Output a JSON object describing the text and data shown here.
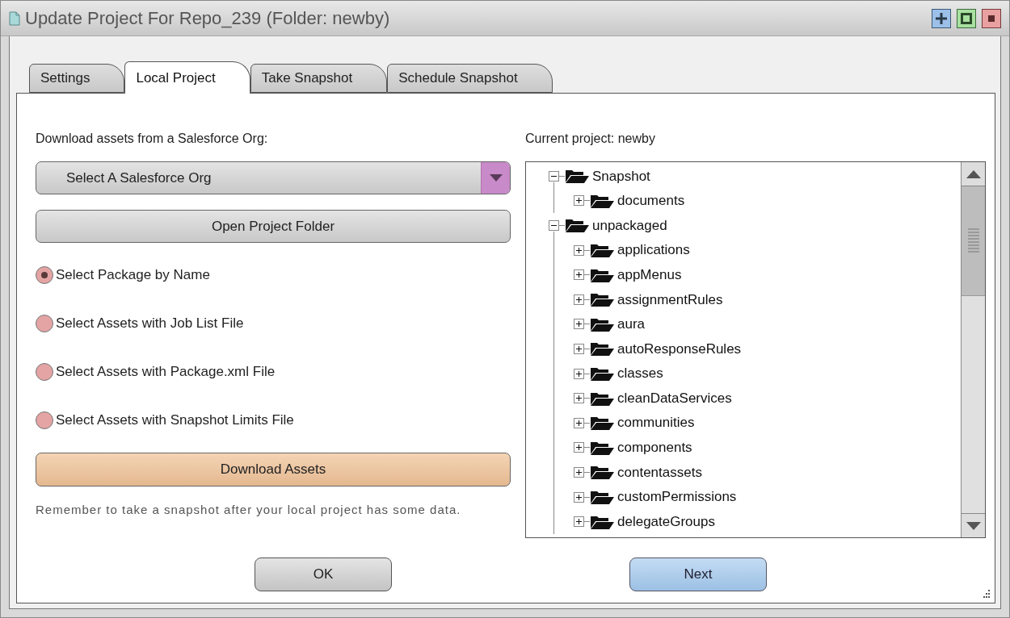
{
  "window": {
    "title": "Update Project For Repo_239 (Folder: newby)"
  },
  "tabs": [
    {
      "label": "Settings",
      "selected": false
    },
    {
      "label": "Local Project",
      "selected": true
    },
    {
      "label": "Take Snapshot",
      "selected": false
    },
    {
      "label": "Schedule Snapshot",
      "selected": false
    }
  ],
  "left": {
    "heading": "Download assets from a Salesforce Org:",
    "org_select": {
      "value": "Select A Salesforce Org"
    },
    "open_button": "Open Project Folder",
    "options": [
      {
        "label": "Select Package by Name",
        "selected": true
      },
      {
        "label": "Select Assets with Job List File",
        "selected": false
      },
      {
        "label": "Select Assets with Package.xml File",
        "selected": false
      },
      {
        "label": "Select Assets with Snapshot Limits File",
        "selected": false
      }
    ],
    "download_button": "Download Assets",
    "note": "Remember to take a snapshot after your local project has some data."
  },
  "right": {
    "heading": "Current project: newby",
    "tree": [
      {
        "label": "Snapshot",
        "expanded": true,
        "children": [
          {
            "label": "documents",
            "expanded": false
          }
        ]
      },
      {
        "label": "unpackaged",
        "expanded": true,
        "children": [
          {
            "label": "applications",
            "expanded": false
          },
          {
            "label": "appMenus",
            "expanded": false
          },
          {
            "label": "assignmentRules",
            "expanded": false
          },
          {
            "label": "aura",
            "expanded": false
          },
          {
            "label": "autoResponseRules",
            "expanded": false
          },
          {
            "label": "classes",
            "expanded": false
          },
          {
            "label": "cleanDataServices",
            "expanded": false
          },
          {
            "label": "communities",
            "expanded": false
          },
          {
            "label": "components",
            "expanded": false
          },
          {
            "label": "contentassets",
            "expanded": false
          },
          {
            "label": "customPermissions",
            "expanded": false
          },
          {
            "label": "delegateGroups",
            "expanded": false
          }
        ]
      }
    ]
  },
  "buttons": [
    "OK",
    "Next"
  ]
}
